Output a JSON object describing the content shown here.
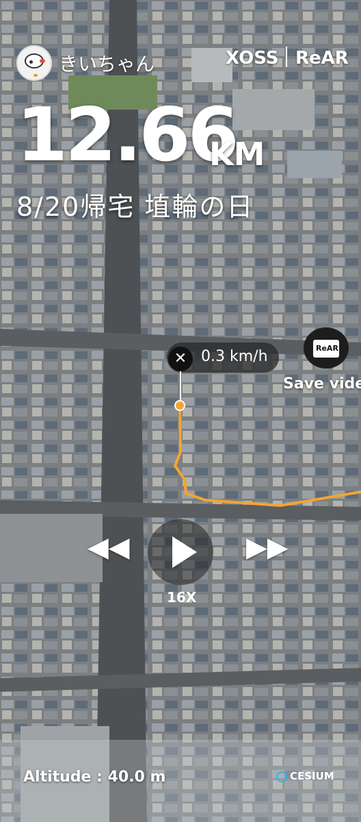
{
  "header": {
    "username": "きいちゃん",
    "brand_left": "XOSS",
    "brand_right": "ReAR"
  },
  "ride": {
    "distance": "12.66",
    "unit": "KM",
    "title": "8/20帰宅 埴輪の日"
  },
  "player": {
    "speed": "0.3 km/h",
    "save_label": "Save video",
    "save_icon_text": "ReAR",
    "multiplier": "16X"
  },
  "footer": {
    "altitude": "Altitude : 40.0 m",
    "credit": "CESIUM"
  },
  "colors": {
    "route": "#f3a532",
    "text": "#ffffff"
  }
}
